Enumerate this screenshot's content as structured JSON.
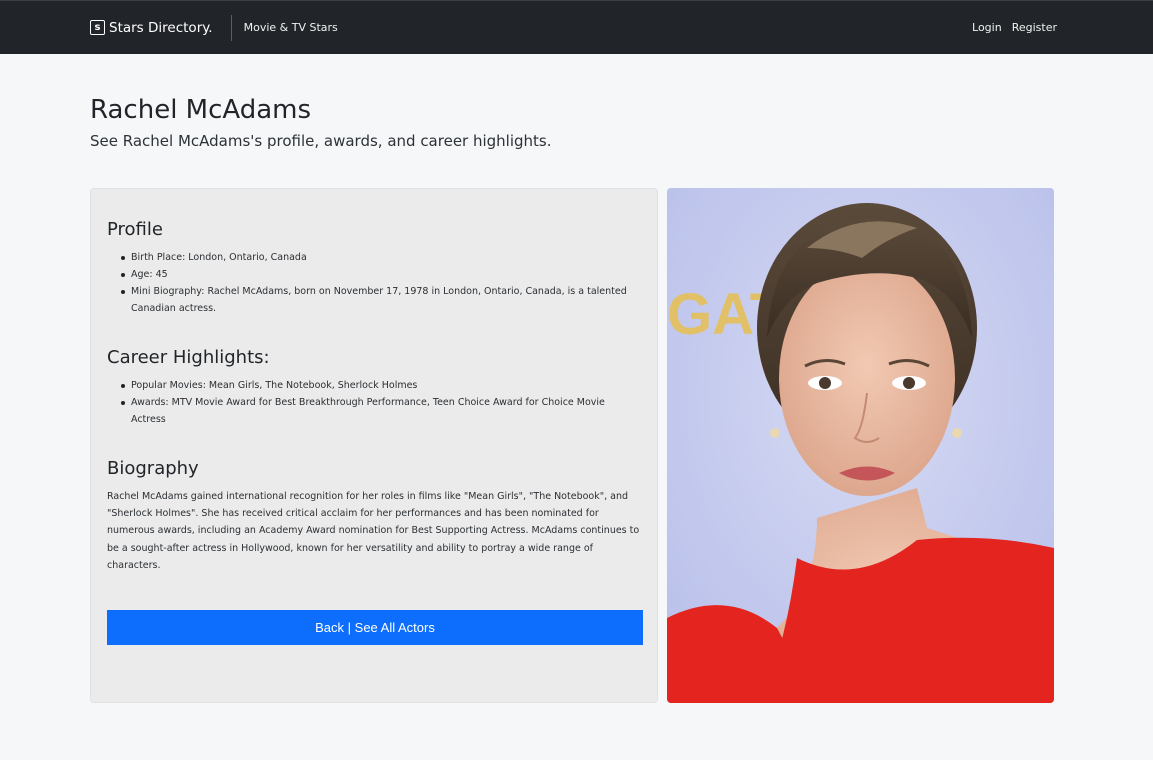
{
  "navbar": {
    "brand_icon_text": "s",
    "brand_name": "Stars Directory.",
    "section_link": "Movie & TV Stars",
    "login": "Login",
    "register": "Register"
  },
  "header": {
    "title": "Rachel McAdams",
    "subtitle": "See Rachel McAdams's profile, awards, and career highlights."
  },
  "profile": {
    "title": "Profile",
    "items": [
      "Birth Place: London, Ontario, Canada",
      "Age: 45",
      "Mini Biography: Rachel McAdams, born on November 17, 1978 in London, Ontario, Canada, is a talented Canadian actress."
    ]
  },
  "career": {
    "title": "Career Highlights:",
    "items": [
      "Popular Movies: Mean Girls, The Notebook, Sherlock Holmes",
      "Awards: MTV Movie Award for Best Breakthrough Performance, Teen Choice Award for Choice Movie Actress"
    ]
  },
  "biography": {
    "title": "Biography",
    "text": "Rachel McAdams gained international recognition for her roles in films like \"Mean Girls\", \"The Notebook\", and \"Sherlock Holmes\". She has received critical acclaim for her performances and has been nominated for numerous awards, including an Academy Award nomination for Best Supporting Actress. McAdams continues to be a sought-after actress in Hollywood, known for her versatility and ability to portray a wide range of characters."
  },
  "back_button": "Back | See All Actors",
  "photo": {
    "backdrop_text": "GAT"
  },
  "colors": {
    "navbar_bg": "#212529",
    "primary": "#0d6efd",
    "card_bg": "#ebebeb",
    "page_bg": "#f6f7f9"
  }
}
